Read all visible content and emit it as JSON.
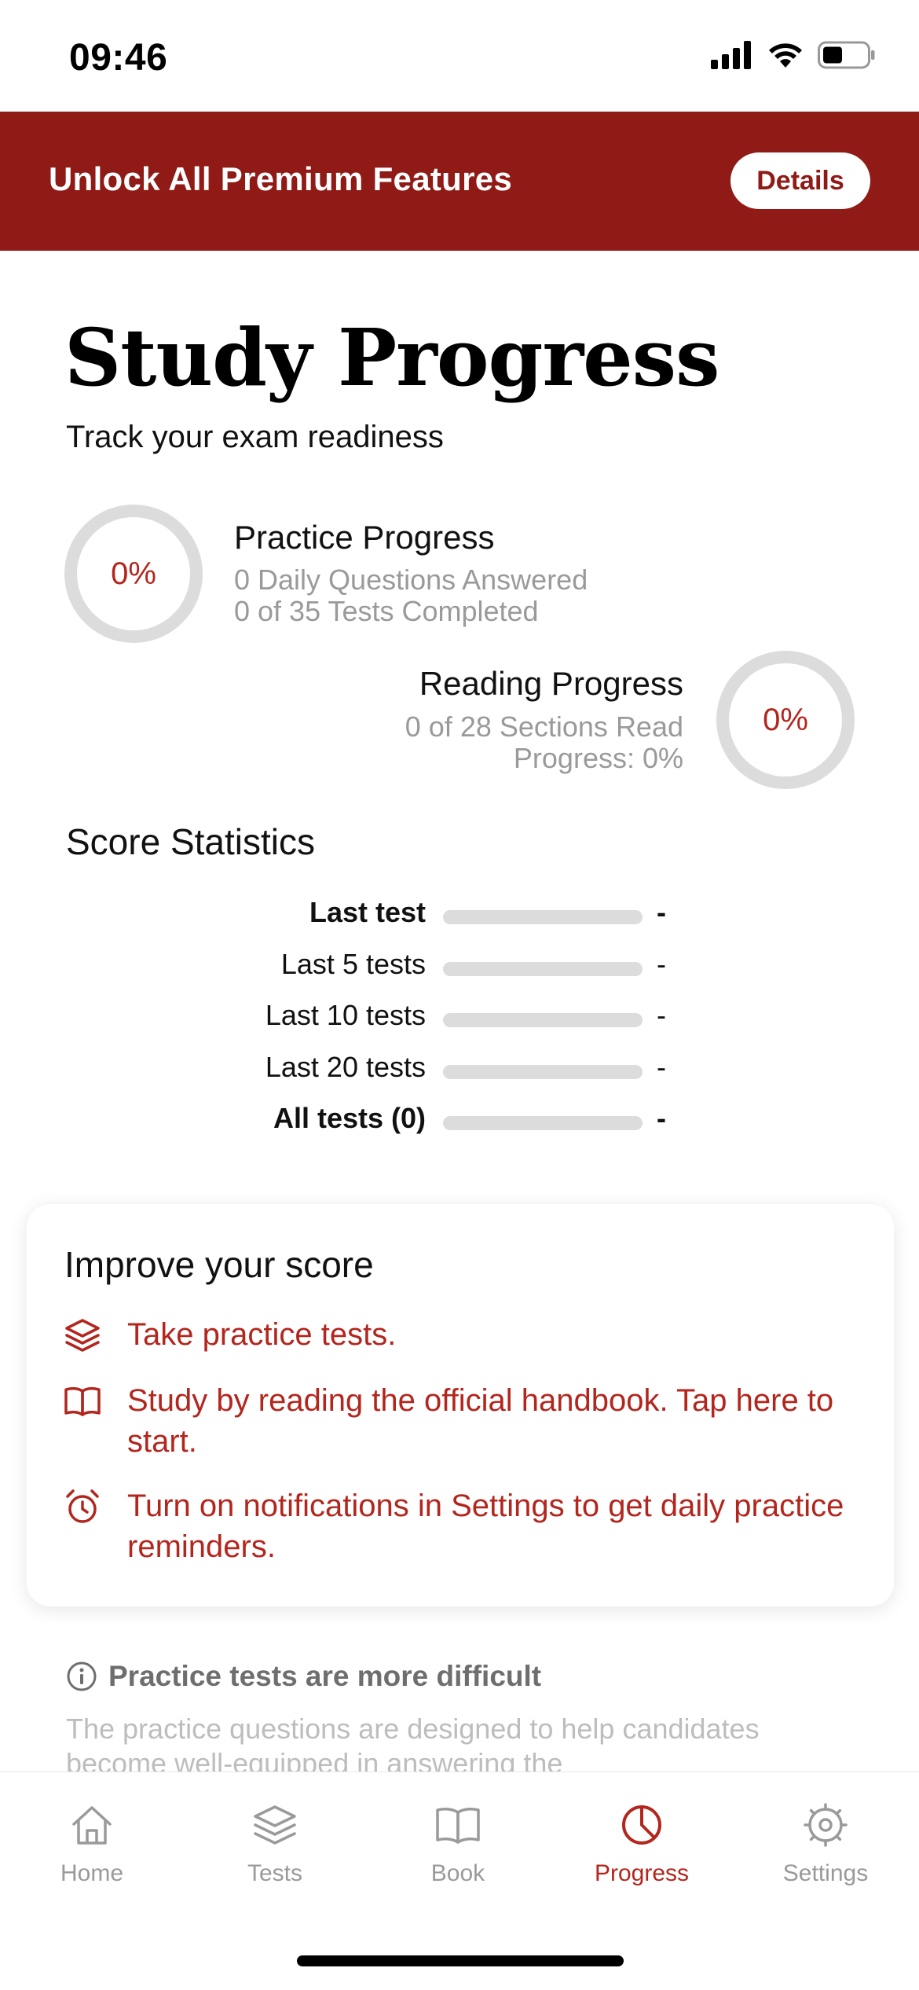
{
  "status": {
    "time": "09:46"
  },
  "banner": {
    "text": "Unlock All Premium Features",
    "button": "Details",
    "color": "#8f1a16"
  },
  "page": {
    "title": "Study Progress",
    "subtitle": "Track your exam readiness"
  },
  "practice": {
    "percent": "0%",
    "heading": "Practice Progress",
    "line1": "0 Daily Questions Answered",
    "line2": "0 of 35 Tests Completed"
  },
  "reading": {
    "percent": "0%",
    "heading": "Reading Progress",
    "line1": "0 of 28 Sections Read",
    "line2": "Progress: 0%"
  },
  "stats": {
    "title": "Score Statistics",
    "rows": [
      {
        "label": "Last test",
        "value": "-"
      },
      {
        "label": "Last 5 tests",
        "value": "-"
      },
      {
        "label": "Last 10 tests",
        "value": "-"
      },
      {
        "label": "Last 20 tests",
        "value": "-"
      },
      {
        "label": "All tests (0)",
        "value": "-"
      }
    ]
  },
  "improve": {
    "title": "Improve your score",
    "tips": [
      {
        "icon": "layers-icon",
        "text": "Take practice tests."
      },
      {
        "icon": "book-icon",
        "text": "Study by reading the official handbook. Tap here to start."
      },
      {
        "icon": "alarm-clock-icon",
        "text": "Turn on notifications in Settings to get daily practice reminders."
      }
    ]
  },
  "info": {
    "heading": "Practice tests are more difficult",
    "body": "The practice questions are designed to help candidates become well-equipped in answering the"
  },
  "tabs": [
    {
      "label": "Home",
      "icon": "home-icon"
    },
    {
      "label": "Tests",
      "icon": "layers-icon"
    },
    {
      "label": "Book",
      "icon": "book-icon"
    },
    {
      "label": "Progress",
      "icon": "pie-chart-icon",
      "active": true
    },
    {
      "label": "Settings",
      "icon": "gear-icon"
    }
  ],
  "colors": {
    "accent": "#b3261e",
    "ring": "#dcdcdc"
  }
}
